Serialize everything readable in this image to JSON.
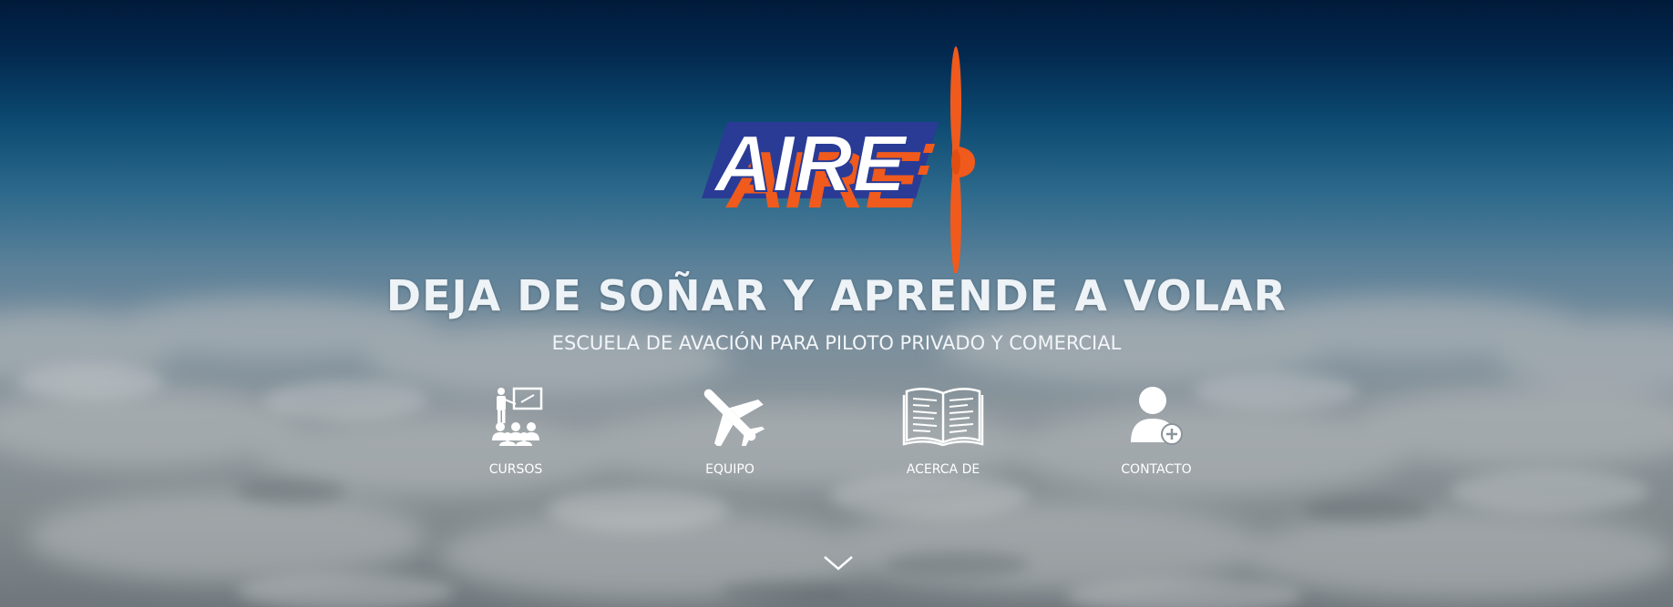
{
  "logo": {
    "text": "AIRE",
    "colors": {
      "blue": "#2a3b96",
      "orange": "#f05a1c",
      "white": "#ffffff"
    }
  },
  "hero": {
    "title": "DEJA DE SOÑAR Y APRENDE A VOLAR",
    "subtitle": "ESCUELA DE AVACIÓN PARA PILOTO PRIVADO Y COMERCIAL"
  },
  "nav": [
    {
      "label": "CURSOS",
      "icon": "classroom-icon"
    },
    {
      "label": "EQUIPO",
      "icon": "airplane-icon"
    },
    {
      "label": "ACERCA DE",
      "icon": "open-book-icon"
    },
    {
      "label": "CONTACTO",
      "icon": "add-user-icon"
    }
  ],
  "scroll_indicator": {
    "icon": "chevron-down-icon"
  }
}
